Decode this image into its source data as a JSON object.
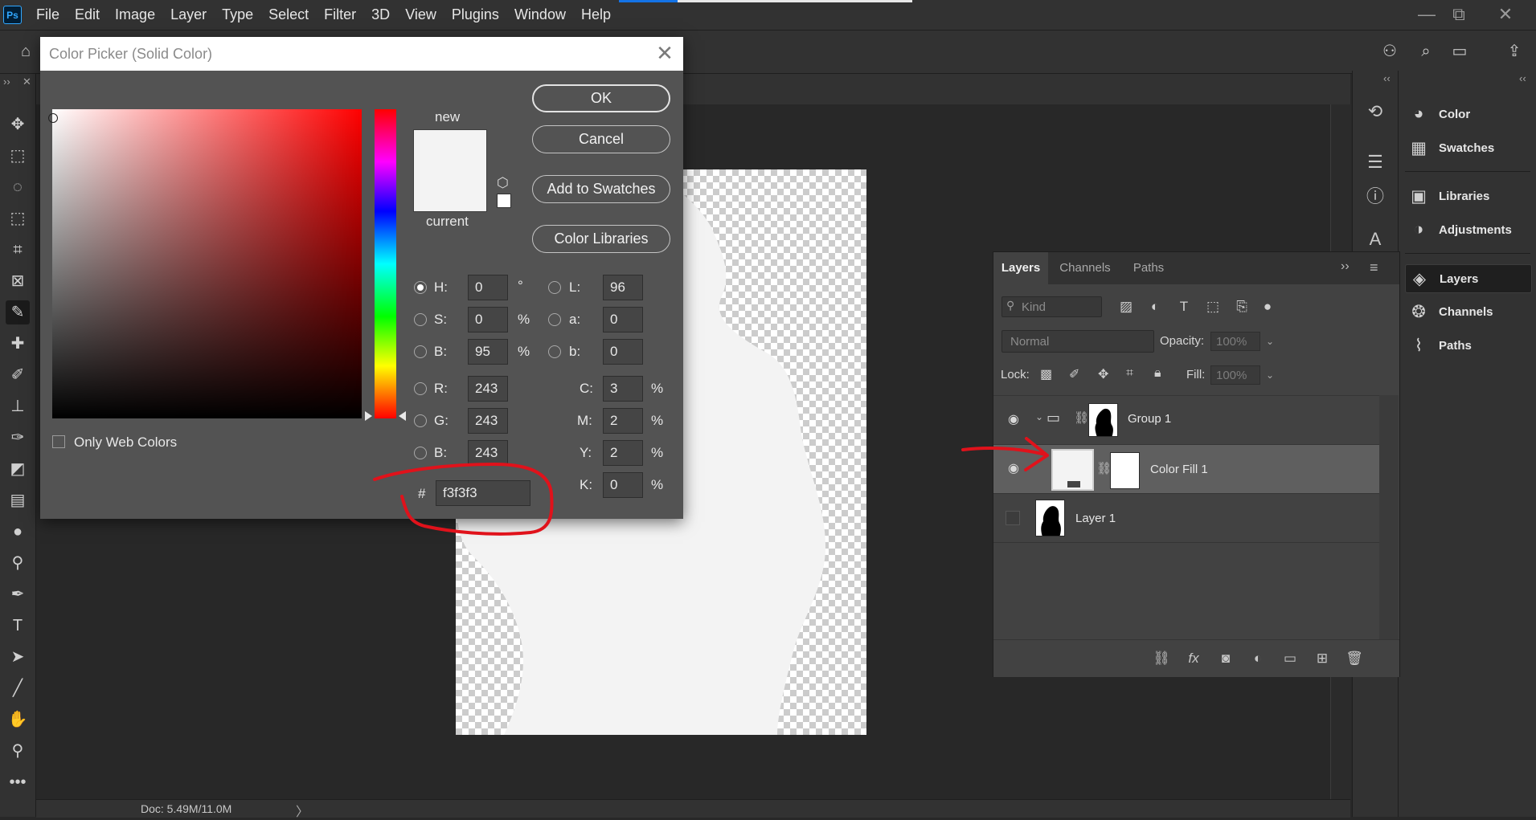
{
  "app": {
    "logo_text": "Ps",
    "menu": [
      "File",
      "Edit",
      "Image",
      "Layer",
      "Type",
      "Select",
      "Filter",
      "3D",
      "View",
      "Plugins",
      "Window",
      "Help"
    ],
    "window_controls": {
      "minimize": "—",
      "restore": "⧉",
      "close": "✕"
    }
  },
  "status": {
    "doc_info": "Doc: 5.49M/11.0M",
    "chevron": "〉"
  },
  "dock": {
    "collapse_glyph": "‹‹",
    "items": [
      {
        "label": "Color",
        "icon": "palette-icon"
      },
      {
        "label": "Swatches",
        "icon": "grid-icon"
      },
      {
        "label": "Libraries",
        "icon": "library-icon"
      },
      {
        "label": "Adjustments",
        "icon": "adjust-icon"
      },
      {
        "label": "Layers",
        "icon": "layers-icon"
      },
      {
        "label": "Channels",
        "icon": "channels-icon"
      },
      {
        "label": "Paths",
        "icon": "paths-icon"
      }
    ],
    "active": "Layers"
  },
  "layers_panel": {
    "tabs": [
      "Layers",
      "Channels",
      "Paths"
    ],
    "active_tab": "Layers",
    "kind_placeholder": "Kind",
    "blend_mode": "Normal",
    "opacity_label": "Opacity:",
    "opacity_value": "100%",
    "lock_label": "Lock:",
    "fill_label": "Fill:",
    "fill_value": "100%",
    "layers": [
      {
        "name": "Group 1",
        "type": "group",
        "visible": true,
        "selected": false
      },
      {
        "name": "Color Fill 1",
        "type": "fill",
        "visible": true,
        "selected": true
      },
      {
        "name": "Layer 1",
        "type": "pixel",
        "visible": false,
        "selected": false
      }
    ]
  },
  "color_picker": {
    "title": "Color Picker (Solid Color)",
    "new_label": "new",
    "current_label": "current",
    "swatch_color": "#f3f3f3",
    "buttons": {
      "ok": "OK",
      "cancel": "Cancel",
      "add_swatches": "Add to Swatches",
      "libraries": "Color Libraries"
    },
    "fields": {
      "H": {
        "label": "H:",
        "value": "0",
        "unit": "°"
      },
      "S": {
        "label": "S:",
        "value": "0",
        "unit": "%"
      },
      "B": {
        "label": "B:",
        "value": "95",
        "unit": "%"
      },
      "R": {
        "label": "R:",
        "value": "243"
      },
      "G": {
        "label": "G:",
        "value": "243"
      },
      "B2": {
        "label": "B:",
        "value": "243"
      },
      "L": {
        "label": "L:",
        "value": "96"
      },
      "a": {
        "label": "a:",
        "value": "0"
      },
      "b": {
        "label": "b:",
        "value": "0"
      },
      "C": {
        "label": "C:",
        "value": "3",
        "unit": "%"
      },
      "M": {
        "label": "M:",
        "value": "2",
        "unit": "%"
      },
      "Y": {
        "label": "Y:",
        "value": "2",
        "unit": "%"
      },
      "K": {
        "label": "K:",
        "value": "0",
        "unit": "%"
      }
    },
    "hex_label": "#",
    "hex_value": "f3f3f3",
    "web_colors_label": "Only Web Colors",
    "selected_channel": "H"
  },
  "colors": {
    "accent": "#1473e6",
    "annotation": "#e0121b",
    "fill": "#f3f3f3",
    "panel": "#424242",
    "dialog": "#535353"
  }
}
